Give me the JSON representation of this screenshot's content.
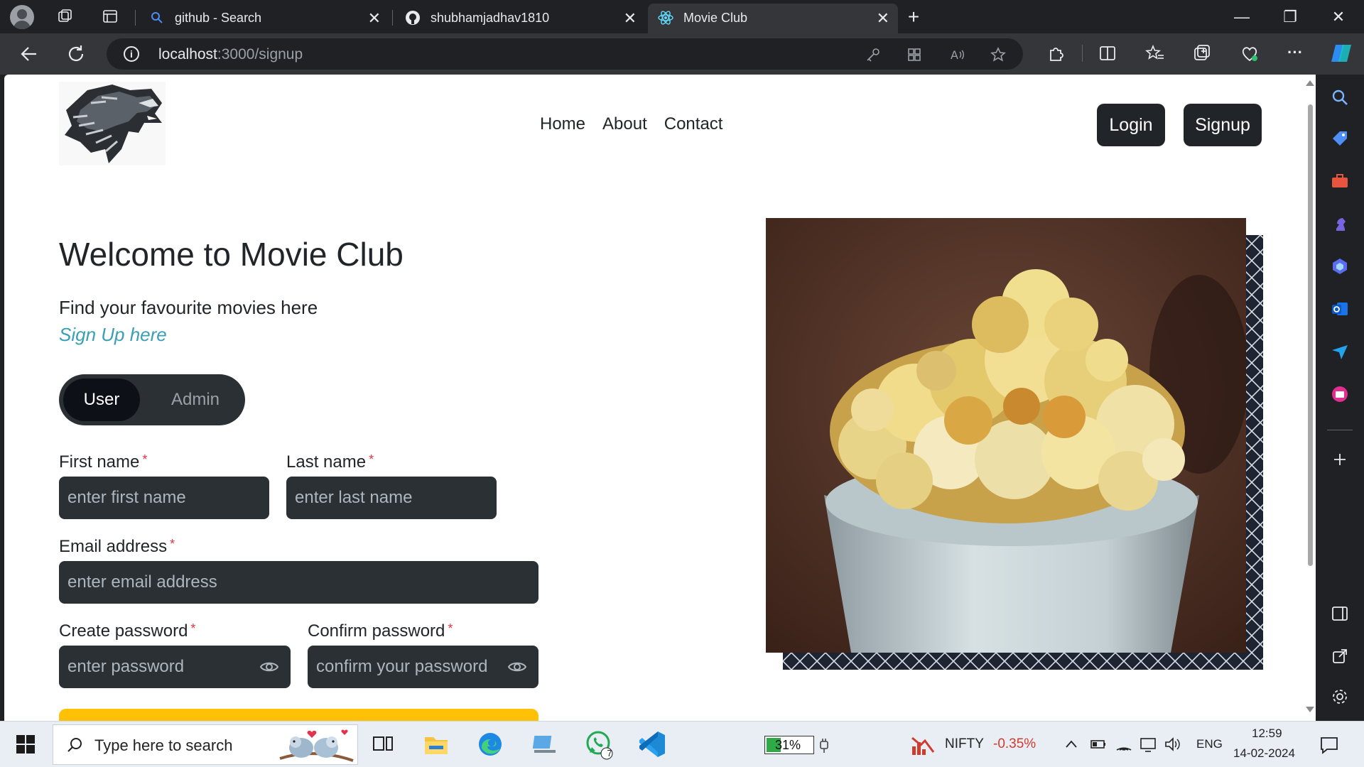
{
  "browser": {
    "tabs": [
      {
        "label": "github - Search",
        "icon": "search-icon",
        "close": "✕"
      },
      {
        "label": "shubhamjadhav1810",
        "icon": "github-icon",
        "close": "✕"
      },
      {
        "label": "Movie Club",
        "icon": "react-icon",
        "close": "✕",
        "active": true
      }
    ],
    "new_tab": "+",
    "window": {
      "minimize": "—",
      "restore": "❐",
      "close": "✕"
    },
    "url_host": "localhost",
    "url_path": ":3000/signup",
    "more": "···"
  },
  "site": {
    "nav": {
      "home": "Home",
      "about": "About",
      "contact": "Contact"
    },
    "login_label": "Login",
    "signup_label": "Signup",
    "hero": {
      "title": "Welcome to Movie Club",
      "subtitle": "Find your favourite movies here",
      "link": "Sign Up here"
    },
    "role_toggle": {
      "user": "User",
      "admin": "Admin",
      "selected": "User"
    },
    "form": {
      "required_mark": "*",
      "first_name": {
        "label": "First name",
        "placeholder": "enter first name"
      },
      "last_name": {
        "label": "Last name",
        "placeholder": "enter last name"
      },
      "email": {
        "label": "Email address",
        "placeholder": "enter email address"
      },
      "password": {
        "label": "Create password",
        "placeholder": "enter password"
      },
      "confirm": {
        "label": "Confirm password",
        "placeholder": "confirm your password"
      }
    },
    "colors": {
      "dark": "#212529",
      "accent_link": "#3a9fb5",
      "required": "#dc3545",
      "submit": "#ffc107"
    }
  },
  "taskbar": {
    "search_placeholder": "Type here to search",
    "battery": "31%",
    "ticker_name": "NIFTY",
    "ticker_change": "-0.35%",
    "language": "ENG",
    "time": "12:59",
    "date": "14-02-2024",
    "whatsapp_badge": "7"
  }
}
